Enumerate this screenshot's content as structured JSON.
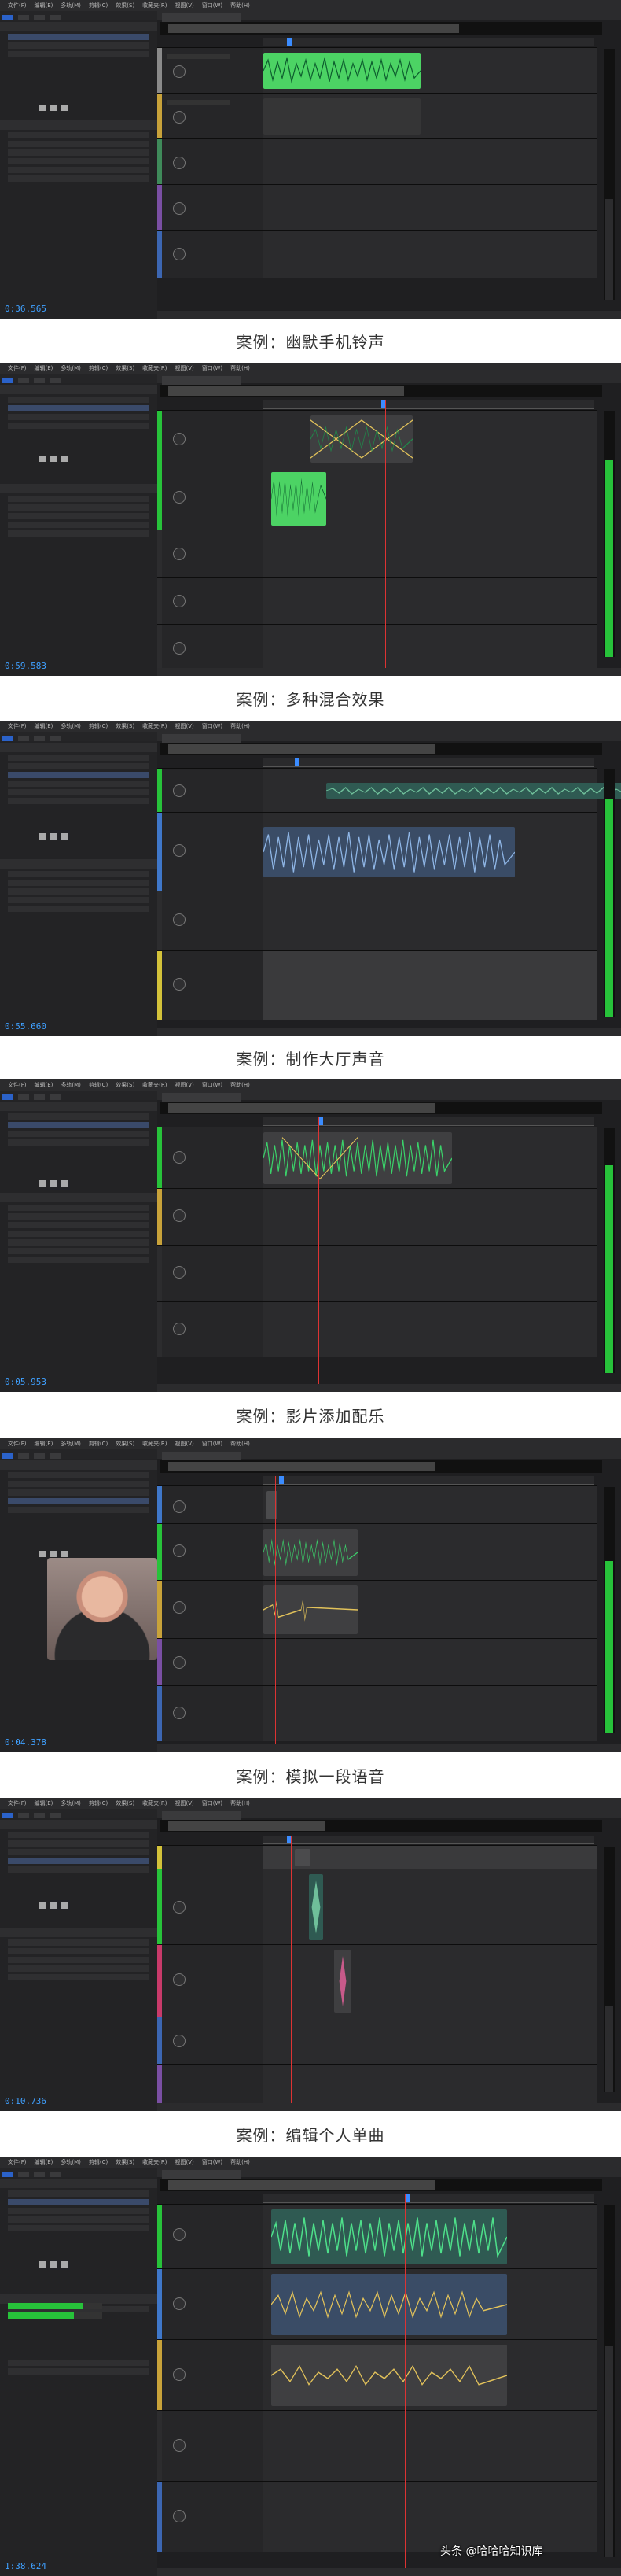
{
  "menu": [
    "文件(F)",
    "编辑(E)",
    "多轨(M)",
    "剪辑(C)",
    "效果(S)",
    "收藏夹(R)",
    "视图(V)",
    "窗口(W)",
    "帮助(H)"
  ],
  "captions": [
    "案例：幽默手机铃声",
    "案例：多种混合效果",
    "案例：制作大厅声音",
    "案例：影片添加配乐",
    "案例：模拟一段语音",
    "案例：编辑个人单曲"
  ],
  "panels": [
    {
      "name": "panel-1",
      "time": "0:36.565"
    },
    {
      "name": "panel-2",
      "time": "0:59.583"
    },
    {
      "name": "panel-3",
      "time": "0:55.660"
    },
    {
      "name": "panel-4",
      "time": "0:05.953"
    },
    {
      "name": "panel-5",
      "time": "0:04.378"
    },
    {
      "name": "panel-6",
      "time": "0:10.736"
    },
    {
      "name": "panel-7",
      "time": "1:38.624"
    }
  ],
  "watermark": "头条 @哈哈哈知识库",
  "colors": {
    "accent": "#3b8cff",
    "clip_green": "#1aa75a",
    "meter_green": "#27c23a",
    "playhead": "#d33333"
  }
}
